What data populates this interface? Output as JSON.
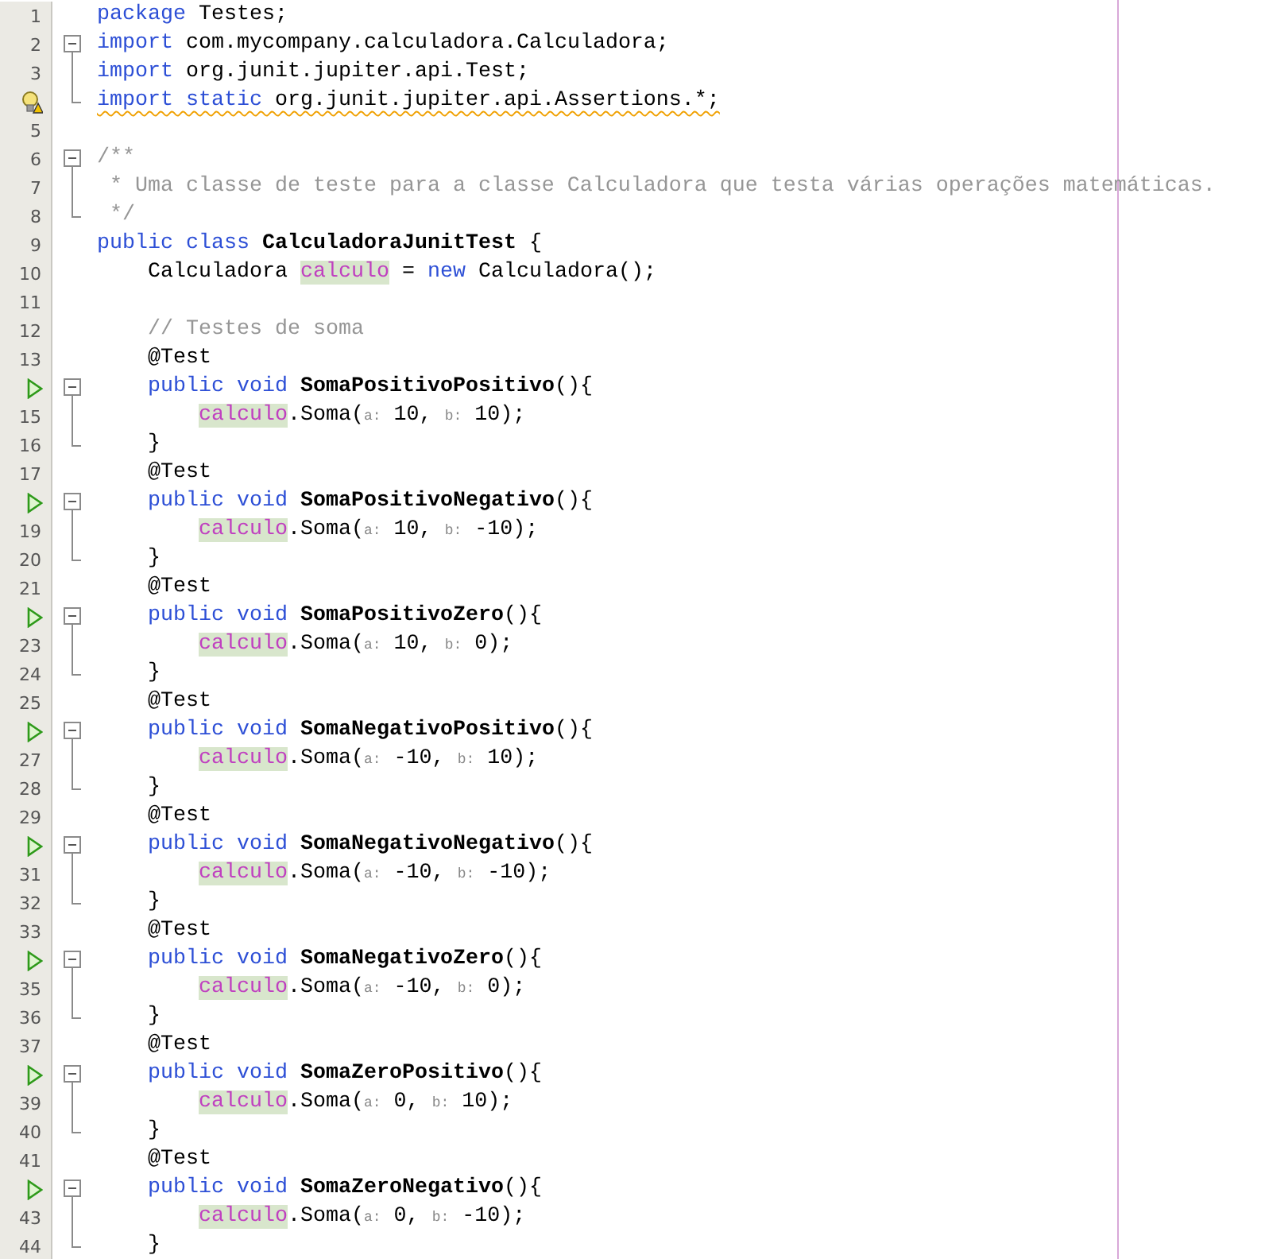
{
  "editor": {
    "lines": [
      {
        "number": "1",
        "kind": "top",
        "tokens": [
          {
            "kind": "kw",
            "text": "package "
          },
          {
            "kind": "txt",
            "text": "Testes;"
          }
        ]
      },
      {
        "number": "2",
        "kind": "top",
        "expanded": true,
        "tokens": [
          {
            "kind": "kw",
            "text": "import "
          },
          {
            "kind": "txt",
            "text": "com.mycompany.calculadora.Calculadora;"
          }
        ],
        "children": [
          {
            "number": "3",
            "kind": "top",
            "tokens": [
              {
                "kind": "kw",
                "text": "import "
              },
              {
                "kind": "txt",
                "text": "org.junit.jupiter.api.Test;"
              }
            ]
          },
          {
            "kind": "top",
            "warning": true,
            "tokens": [
              {
                "kind": "kw",
                "text": "import static "
              },
              {
                "kind": "txt",
                "text": "org.junit.jupiter.api.Assertions.*;"
              }
            ]
          }
        ]
      },
      {
        "number": "5"
      },
      {
        "number": "6",
        "kind": "top",
        "expanded": true,
        "tokens": [
          {
            "kind": "comment",
            "text": "/**"
          }
        ],
        "children": [
          {
            "number": "7",
            "kind": "top",
            "tokens": [
              {
                "kind": "comment",
                "text": " * Uma classe de teste para a classe Calculadora que testa várias operações matemáticas."
              }
            ]
          },
          {
            "number": "8",
            "kind": "top",
            "tokens": [
              {
                "kind": "comment",
                "text": " */"
              }
            ]
          }
        ]
      },
      {
        "number": "9",
        "kind": "top",
        "tokens": [
          {
            "kind": "kw",
            "text": "public class "
          },
          {
            "kind": "name",
            "text": "CalculadoraJunitTest"
          },
          {
            "kind": "txt",
            "text": " {"
          }
        ]
      },
      {
        "number": "10",
        "kind": "member",
        "tokens": [
          {
            "kind": "txt",
            "text": "Calculadora "
          },
          {
            "kind": "field",
            "text": "calculo"
          },
          {
            "kind": "txt",
            "text": " = "
          },
          {
            "kind": "kw",
            "text": "new"
          },
          {
            "kind": "txt",
            "text": " Calculadora();"
          }
        ]
      },
      {
        "number": "11"
      },
      {
        "number": "12",
        "kind": "member",
        "tokens": [
          {
            "kind": "comment",
            "text": "// Testes de soma"
          }
        ]
      },
      {
        "number": "13",
        "kind": "member",
        "tokens": [
          {
            "kind": "txt",
            "text": "@Test"
          }
        ]
      },
      {
        "kind": "member",
        "runnable": true,
        "expanded": true,
        "tokens": [
          {
            "kind": "kw",
            "text": "public void "
          },
          {
            "kind": "name",
            "text": "SomaPositivoPositivo"
          },
          {
            "kind": "txt",
            "text": "(){"
          }
        ],
        "children": [
          {
            "number": "15",
            "kind": "body",
            "tokens": [
              {
                "kind": "field",
                "text": "calculo"
              },
              {
                "kind": "txt",
                "text": ".Soma("
              },
              {
                "kind": "hint",
                "text": "a:"
              },
              {
                "kind": "txt",
                "text": " 10, "
              },
              {
                "kind": "hint",
                "text": "b:"
              },
              {
                "kind": "txt",
                "text": " 10);"
              }
            ]
          },
          {
            "number": "16",
            "kind": "member",
            "tokens": [
              {
                "kind": "txt",
                "text": "}"
              }
            ]
          }
        ]
      },
      {
        "number": "17",
        "kind": "member",
        "tokens": [
          {
            "kind": "txt",
            "text": "@Test"
          }
        ]
      },
      {
        "kind": "member",
        "runnable": true,
        "expanded": true,
        "tokens": [
          {
            "kind": "kw",
            "text": "public void "
          },
          {
            "kind": "name",
            "text": "SomaPositivoNegativo"
          },
          {
            "kind": "txt",
            "text": "(){"
          }
        ],
        "children": [
          {
            "number": "19",
            "kind": "body",
            "tokens": [
              {
                "kind": "field",
                "text": "calculo"
              },
              {
                "kind": "txt",
                "text": ".Soma("
              },
              {
                "kind": "hint",
                "text": "a:"
              },
              {
                "kind": "txt",
                "text": " 10, "
              },
              {
                "kind": "hint",
                "text": "b:"
              },
              {
                "kind": "txt",
                "text": " -10);"
              }
            ]
          },
          {
            "number": "20",
            "kind": "member",
            "tokens": [
              {
                "kind": "txt",
                "text": "}"
              }
            ]
          }
        ]
      },
      {
        "number": "21",
        "kind": "member",
        "tokens": [
          {
            "kind": "txt",
            "text": "@Test"
          }
        ]
      },
      {
        "kind": "member",
        "runnable": true,
        "expanded": true,
        "tokens": [
          {
            "kind": "kw",
            "text": "public void "
          },
          {
            "kind": "name",
            "text": "SomaPositivoZero"
          },
          {
            "kind": "txt",
            "text": "(){"
          }
        ],
        "children": [
          {
            "number": "23",
            "kind": "body",
            "tokens": [
              {
                "kind": "field",
                "text": "calculo"
              },
              {
                "kind": "txt",
                "text": ".Soma("
              },
              {
                "kind": "hint",
                "text": "a:"
              },
              {
                "kind": "txt",
                "text": " 10, "
              },
              {
                "kind": "hint",
                "text": "b:"
              },
              {
                "kind": "txt",
                "text": " 0);"
              }
            ]
          },
          {
            "number": "24",
            "kind": "member",
            "tokens": [
              {
                "kind": "txt",
                "text": "}"
              }
            ]
          }
        ]
      },
      {
        "number": "25",
        "kind": "member",
        "tokens": [
          {
            "kind": "txt",
            "text": "@Test"
          }
        ]
      },
      {
        "kind": "member",
        "runnable": true,
        "expanded": true,
        "tokens": [
          {
            "kind": "kw",
            "text": "public void "
          },
          {
            "kind": "name",
            "text": "SomaNegativoPositivo"
          },
          {
            "kind": "txt",
            "text": "(){"
          }
        ],
        "children": [
          {
            "number": "27",
            "kind": "body",
            "tokens": [
              {
                "kind": "field",
                "text": "calculo"
              },
              {
                "kind": "txt",
                "text": ".Soma("
              },
              {
                "kind": "hint",
                "text": "a:"
              },
              {
                "kind": "txt",
                "text": " -10, "
              },
              {
                "kind": "hint",
                "text": "b:"
              },
              {
                "kind": "txt",
                "text": " 10);"
              }
            ]
          },
          {
            "number": "28",
            "kind": "member",
            "tokens": [
              {
                "kind": "txt",
                "text": "}"
              }
            ]
          }
        ]
      },
      {
        "number": "29",
        "kind": "member",
        "tokens": [
          {
            "kind": "txt",
            "text": "@Test"
          }
        ]
      },
      {
        "kind": "member",
        "runnable": true,
        "expanded": true,
        "tokens": [
          {
            "kind": "kw",
            "text": "public void "
          },
          {
            "kind": "name",
            "text": "SomaNegativoNegativo"
          },
          {
            "kind": "txt",
            "text": "(){"
          }
        ],
        "children": [
          {
            "number": "31",
            "kind": "body",
            "tokens": [
              {
                "kind": "field",
                "text": "calculo"
              },
              {
                "kind": "txt",
                "text": ".Soma("
              },
              {
                "kind": "hint",
                "text": "a:"
              },
              {
                "kind": "txt",
                "text": " -10, "
              },
              {
                "kind": "hint",
                "text": "b:"
              },
              {
                "kind": "txt",
                "text": " -10);"
              }
            ]
          },
          {
            "number": "32",
            "kind": "member",
            "tokens": [
              {
                "kind": "txt",
                "text": "}"
              }
            ]
          }
        ]
      },
      {
        "number": "33",
        "kind": "member",
        "tokens": [
          {
            "kind": "txt",
            "text": "@Test"
          }
        ]
      },
      {
        "kind": "member",
        "runnable": true,
        "expanded": true,
        "tokens": [
          {
            "kind": "kw",
            "text": "public void "
          },
          {
            "kind": "name",
            "text": "SomaNegativoZero"
          },
          {
            "kind": "txt",
            "text": "(){"
          }
        ],
        "children": [
          {
            "number": "35",
            "kind": "body",
            "tokens": [
              {
                "kind": "field",
                "text": "calculo"
              },
              {
                "kind": "txt",
                "text": ".Soma("
              },
              {
                "kind": "hint",
                "text": "a:"
              },
              {
                "kind": "txt",
                "text": " -10, "
              },
              {
                "kind": "hint",
                "text": "b:"
              },
              {
                "kind": "txt",
                "text": " 0);"
              }
            ]
          },
          {
            "number": "36",
            "kind": "member",
            "tokens": [
              {
                "kind": "txt",
                "text": "}"
              }
            ]
          }
        ]
      },
      {
        "number": "37",
        "kind": "member",
        "tokens": [
          {
            "kind": "txt",
            "text": "@Test"
          }
        ]
      },
      {
        "kind": "member",
        "runnable": true,
        "expanded": true,
        "tokens": [
          {
            "kind": "kw",
            "text": "public void "
          },
          {
            "kind": "name",
            "text": "SomaZeroPositivo"
          },
          {
            "kind": "txt",
            "text": "(){"
          }
        ],
        "children": [
          {
            "number": "39",
            "kind": "body",
            "tokens": [
              {
                "kind": "field",
                "text": "calculo"
              },
              {
                "kind": "txt",
                "text": ".Soma("
              },
              {
                "kind": "hint",
                "text": "a:"
              },
              {
                "kind": "txt",
                "text": " 0, "
              },
              {
                "kind": "hint",
                "text": "b:"
              },
              {
                "kind": "txt",
                "text": " 10);"
              }
            ]
          },
          {
            "number": "40",
            "kind": "member",
            "tokens": [
              {
                "kind": "txt",
                "text": "}"
              }
            ]
          }
        ]
      },
      {
        "number": "41",
        "kind": "member",
        "tokens": [
          {
            "kind": "txt",
            "text": "@Test"
          }
        ]
      },
      {
        "kind": "member",
        "runnable": true,
        "expanded": true,
        "tokens": [
          {
            "kind": "kw",
            "text": "public void "
          },
          {
            "kind": "name",
            "text": "SomaZeroNegativo"
          },
          {
            "kind": "txt",
            "text": "(){"
          }
        ],
        "children": [
          {
            "number": "43",
            "kind": "body",
            "tokens": [
              {
                "kind": "field",
                "text": "calculo"
              },
              {
                "kind": "txt",
                "text": ".Soma("
              },
              {
                "kind": "hint",
                "text": "a:"
              },
              {
                "kind": "txt",
                "text": " 0, "
              },
              {
                "kind": "hint",
                "text": "b:"
              },
              {
                "kind": "txt",
                "text": " -10);"
              }
            ]
          },
          {
            "number": "44",
            "kind": "member",
            "tokens": [
              {
                "kind": "txt",
                "text": "}"
              }
            ]
          }
        ]
      }
    ]
  }
}
